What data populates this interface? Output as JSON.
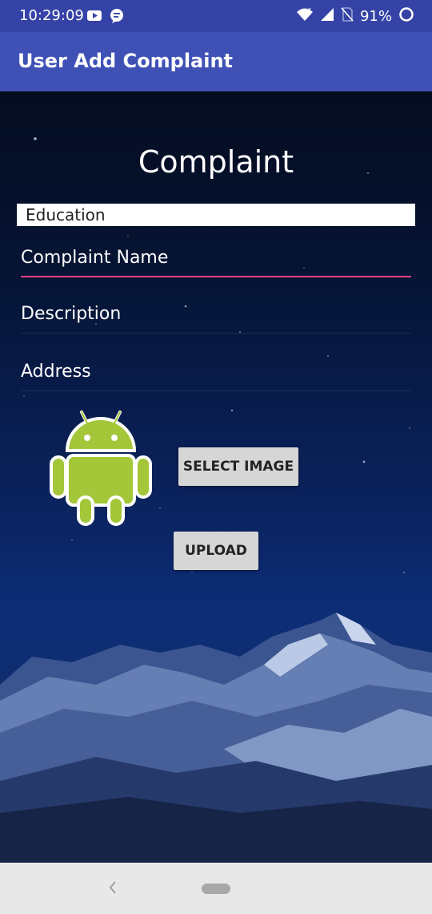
{
  "status_bar": {
    "time": "10:29:09",
    "battery": "91%",
    "icons": [
      "youtube-icon",
      "message-icon",
      "wifi-icon",
      "signal-icon",
      "no-sim-icon",
      "battery-ring-icon"
    ]
  },
  "app_bar": {
    "title": "User Add Complaint"
  },
  "form": {
    "heading": "Complaint",
    "category_selected": "Education",
    "complaint_name_placeholder": "Complaint Name",
    "description_placeholder": "Description",
    "address_placeholder": "Address",
    "select_image_label": "SELECT IMAGE",
    "upload_label": "UPLOAD",
    "preview_image": "android-robot-icon"
  },
  "colors": {
    "status_bar": "#3543a6",
    "app_bar": "#3f51b5",
    "accent": "#ff4081",
    "android_green": "#a4c639"
  },
  "nav_bar": {
    "icons": [
      "back-icon",
      "home-pill-icon"
    ]
  }
}
